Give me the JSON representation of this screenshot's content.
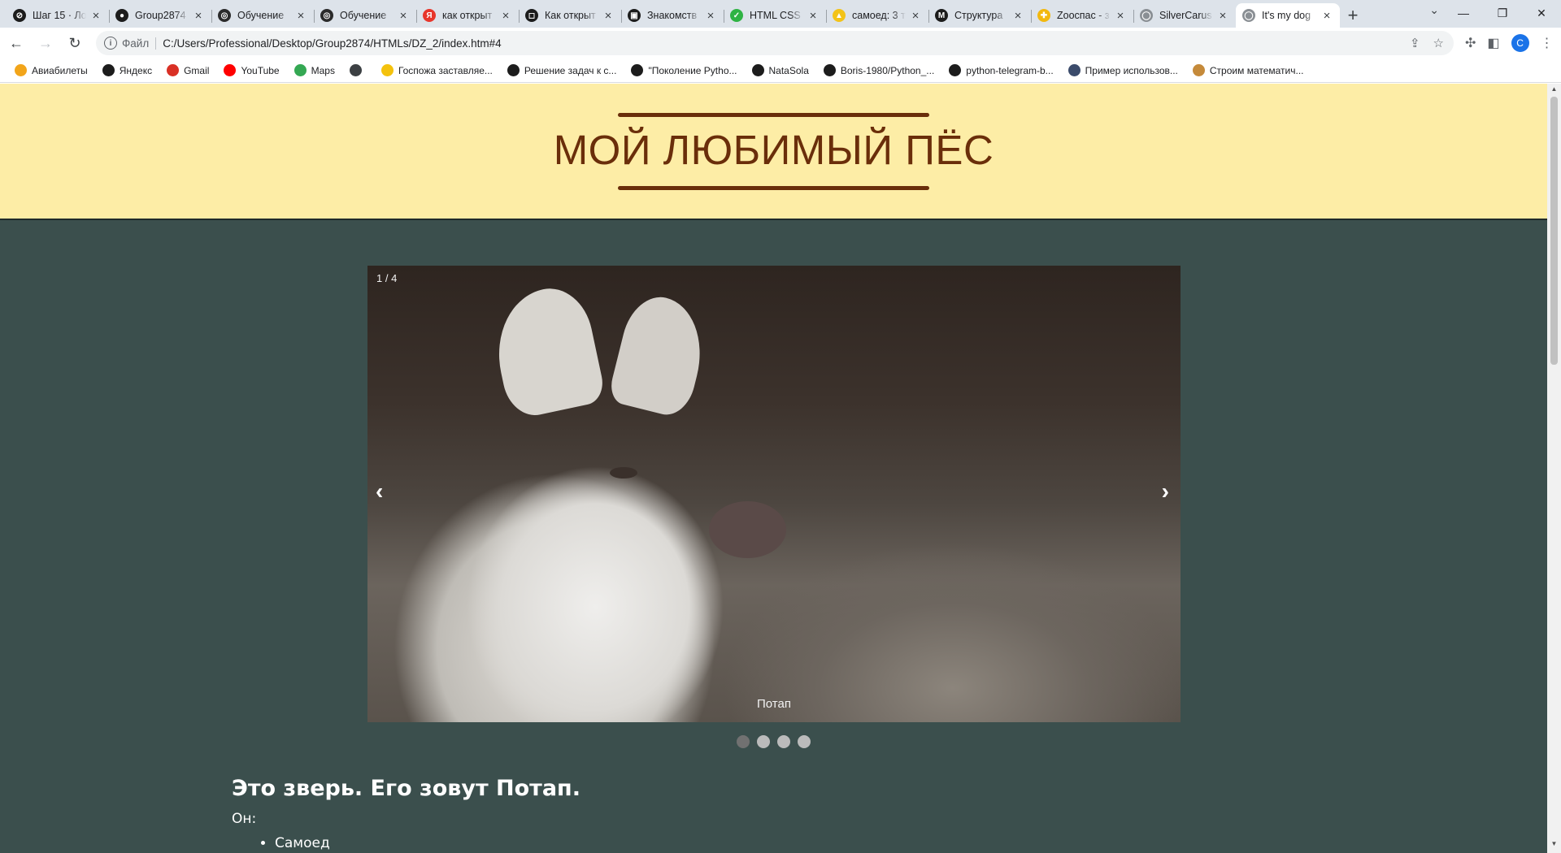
{
  "browser": {
    "tabs": [
      {
        "title": "Шаг 15 · Ло",
        "fav_color": "#1c1c1c",
        "fav_glyph": "⊘"
      },
      {
        "title": "Group2874",
        "fav_color": "#1c1c1c",
        "fav_glyph": "●"
      },
      {
        "title": "Обучение",
        "fav_color": "#2b2b2b",
        "fav_glyph": "◎"
      },
      {
        "title": "Обучение",
        "fav_color": "#2b2b2b",
        "fav_glyph": "◎"
      },
      {
        "title": "как открыт",
        "fav_color": "#e8362b",
        "fav_glyph": "Я"
      },
      {
        "title": "Как открыт",
        "fav_color": "#1c1c1c",
        "fav_glyph": "◻"
      },
      {
        "title": "Знакомств",
        "fav_color": "#1c1c1c",
        "fav_glyph": "▣"
      },
      {
        "title": "HTML CSS",
        "fav_color": "#2fb344",
        "fav_glyph": "✓"
      },
      {
        "title": "самоед: 3 т",
        "fav_color": "#f3c318",
        "fav_glyph": "▲"
      },
      {
        "title": "Структура",
        "fav_color": "#1c1c1c",
        "fav_glyph": "M"
      },
      {
        "title": "Zooспас - з",
        "fav_color": "#f2b80f",
        "fav_glyph": "✚"
      },
      {
        "title": "SilverCarus",
        "fav_color": "#8a8f94",
        "fav_glyph": "◯"
      },
      {
        "title": "It's my dog",
        "fav_color": "#8a8f94",
        "fav_glyph": "◯",
        "active": true
      }
    ],
    "new_tab_label": "+",
    "address": {
      "scheme_label": "Файл",
      "url": "C:/Users/Professional/Desktop/Group2874/HTMLs/DZ_2/index.htm#4"
    },
    "profile_initial": "C",
    "bookmarks": [
      {
        "label": "Авиабилеты",
        "color": "#f2a51a"
      },
      {
        "label": "Яндекс",
        "color": "#1c1c1c"
      },
      {
        "label": "Gmail",
        "color": "#d93025"
      },
      {
        "label": "YouTube",
        "color": "#ff0000"
      },
      {
        "label": "Maps",
        "color": "#34a853"
      },
      {
        "label": "",
        "color": "#3c4043"
      },
      {
        "label": "Госпожа заставляе...",
        "color": "#f4c20d"
      },
      {
        "label": "Решение задач к с...",
        "color": "#1c1c1c"
      },
      {
        "label": "\"Поколение Pytho...",
        "color": "#1c1c1c"
      },
      {
        "label": "NataSola",
        "color": "#1c1c1c"
      },
      {
        "label": "Boris-1980/Python_...",
        "color": "#1c1c1c"
      },
      {
        "label": "python-telegram-b...",
        "color": "#1c1c1c"
      },
      {
        "label": "Пример использов...",
        "color": "#3b4b6b"
      },
      {
        "label": "Строим математич...",
        "color": "#c58a3a"
      }
    ]
  },
  "page": {
    "title": "МОЙ ЛЮБИМЫЙ ПЁС",
    "slideshow": {
      "counter": "1 / 4",
      "caption": "Потап",
      "prev_label": "‹",
      "next_label": "›",
      "dot_count": 4,
      "active_index": 0
    },
    "about": {
      "heading": "Это зверь. Его зовут Потап.",
      "intro": "Он:",
      "traits": [
        "Самоед"
      ]
    }
  },
  "colors": {
    "header_bg": "#fdeda6",
    "title_color": "#6a2e0a",
    "body_bg": "#3b4f4d"
  }
}
